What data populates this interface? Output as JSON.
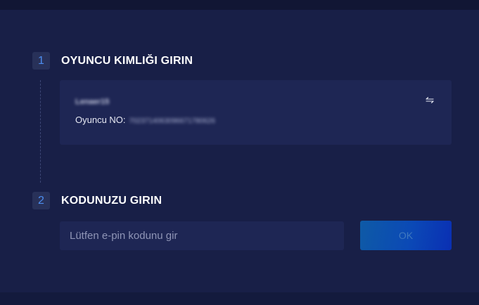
{
  "step1": {
    "number": "1",
    "title": "OYUNCU KIMLIĞI GIRIN"
  },
  "player": {
    "name": "Lenaer15",
    "id_label": "Oyuncu NO:",
    "id_value": "7023714063096671780626",
    "switch_icon": "swap-arrows-icon"
  },
  "step2": {
    "number": "2",
    "title": "KODUNUZU GIRIN"
  },
  "pin": {
    "placeholder": "Lütfen e-pin kodunu gir",
    "value": ""
  },
  "ok_button": {
    "label": "OK"
  },
  "colors": {
    "page_background": "#181f47",
    "card_background": "#1e2654",
    "step_number": "#4d8ef0",
    "button_gradient_start": "#0e5aa6",
    "button_gradient_end": "#0a2fb3"
  }
}
